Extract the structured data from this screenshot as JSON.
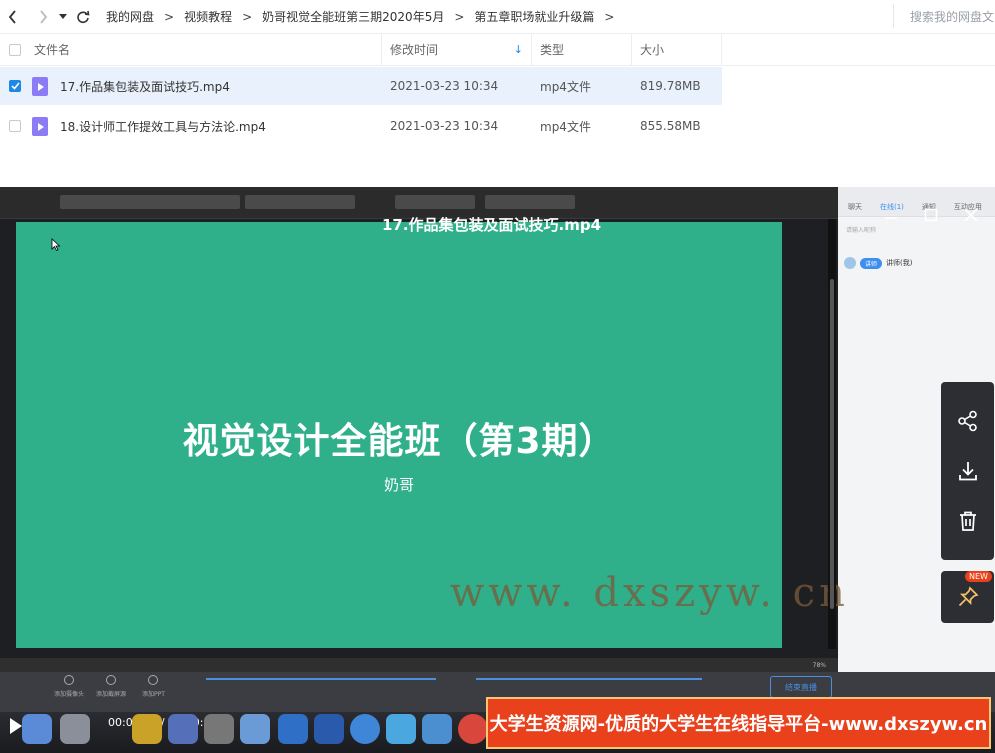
{
  "navbar": {
    "back_icon": "chevron-left-icon",
    "forward_icon": "chevron-right-icon",
    "history_icon": "caret-down-icon",
    "refresh_icon": "refresh-icon",
    "breadcrumbs": [
      "我的网盘",
      "视频教程",
      "奶哥视觉全能班第三期2020年5月",
      "第五章职场就业升级篇"
    ],
    "separator": ">",
    "search_placeholder": "搜索我的网盘文"
  },
  "table": {
    "columns": {
      "name": "文件名",
      "modified": "修改时间",
      "type": "类型",
      "size": "大小"
    },
    "rows": [
      {
        "name": "17.作品集包装及面试技巧.mp4",
        "modified": "2021-03-23 10:34",
        "type": "mp4文件",
        "size": "819.78MB",
        "selected": true
      },
      {
        "name": "18.设计师工作提效工具与方法论.mp4",
        "modified": "2021-03-23 10:34",
        "type": "mp4文件",
        "size": "855.58MB",
        "selected": false
      }
    ]
  },
  "player": {
    "title": "17.作品集包装及面试技巧.mp4",
    "slide_title": "视觉设计全能班（第3期）",
    "slide_subtitle": "奶哥",
    "watermark": "www. dxszyw. cn",
    "time": "00:00:00 / 02:20:58",
    "side_tabs": [
      "聊天",
      "在线(1)",
      "通知",
      "互动应用"
    ],
    "side_input_placeholder": "请输入昵称",
    "chat_badge": "讲师",
    "chat_user": "讲师(我)",
    "end_live_label": "结束直播",
    "live_tools": [
      "添加摄像头",
      "添加截屏源",
      "添加PPT"
    ],
    "status_zoom": "78%",
    "banner_text": "大学生资源网-优质的大学生在线指导平台-www.dxszyw.cn",
    "new_badge": "NEW",
    "accent_color": "#2fb08a",
    "banner_color": "#e8411c"
  }
}
